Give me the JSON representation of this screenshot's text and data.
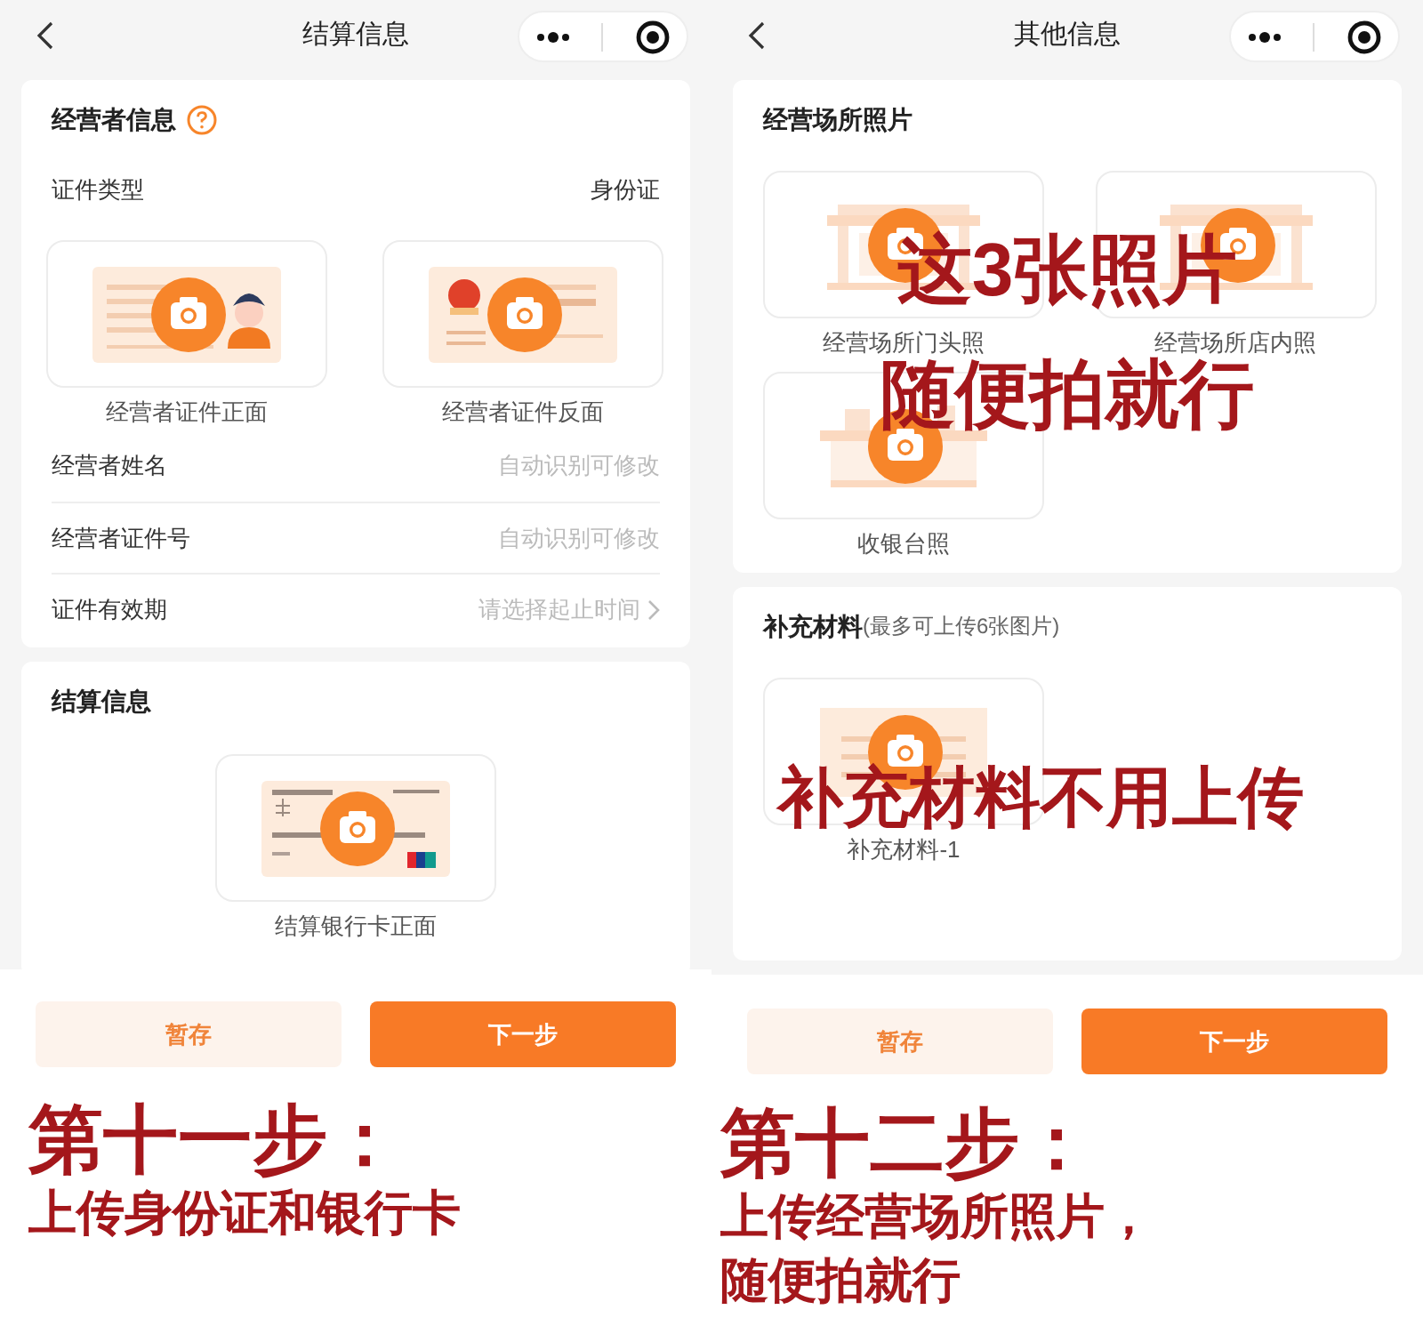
{
  "panels": [
    {
      "title": "结算信息",
      "sections": [
        {
          "title": "经营者信息",
          "help": true,
          "items": [
            {
              "kind": "row",
              "label": "证件类型",
              "value": "身份证"
            },
            {
              "kind": "uploads",
              "tiles": [
                {
                  "kind": "id-front",
                  "label": "经营者证件正面"
                },
                {
                  "kind": "id-back",
                  "label": "经营者证件反面"
                }
              ]
            },
            {
              "kind": "field",
              "label": "经营者姓名",
              "placeholder": "自动识别可修改"
            },
            {
              "kind": "field",
              "label": "经营者证件号",
              "placeholder": "自动识别可修改"
            },
            {
              "kind": "picker",
              "label": "证件有效期",
              "placeholder": "请选择起止时间"
            }
          ]
        },
        {
          "title": "结算信息",
          "items": [
            {
              "kind": "uploads",
              "centered": true,
              "tiles": [
                {
                  "kind": "bank-card",
                  "label": "结算银行卡正面"
                }
              ]
            }
          ]
        }
      ],
      "buttons": [
        {
          "kind": "secondary",
          "label": "暂存"
        },
        {
          "kind": "primary",
          "label": "下一步"
        }
      ],
      "annotation": [
        "第十一步：",
        "上传身份证和银行卡"
      ]
    },
    {
      "title": "其他信息",
      "sections": [
        {
          "title": "经营场所照片",
          "items": [
            {
              "kind": "uploads",
              "tiles": [
                {
                  "kind": "storefront",
                  "label": "经营场所门头照"
                },
                {
                  "kind": "interior",
                  "label": "经营场所店内照"
                },
                {
                  "kind": "counter",
                  "label": "收银台照"
                }
              ]
            }
          ]
        },
        {
          "title": "补充材料",
          "note": "(最多可上传6张图片)",
          "items": [
            {
              "kind": "uploads",
              "tiles": [
                {
                  "kind": "document",
                  "label": "补充材料-1"
                }
              ]
            }
          ]
        }
      ],
      "buttons": [
        {
          "kind": "secondary",
          "label": "暂存"
        },
        {
          "kind": "primary",
          "label": "下一步"
        }
      ],
      "annotation": [
        "第十二步：",
        "上传经营场所照片，",
        "随便拍就行"
      ],
      "overlays": [
        {
          "kind": "photos",
          "lines": [
            "这3张照片",
            "随便拍就行"
          ]
        },
        {
          "kind": "materials",
          "lines": [
            "补充材料不用上传"
          ]
        }
      ]
    }
  ]
}
